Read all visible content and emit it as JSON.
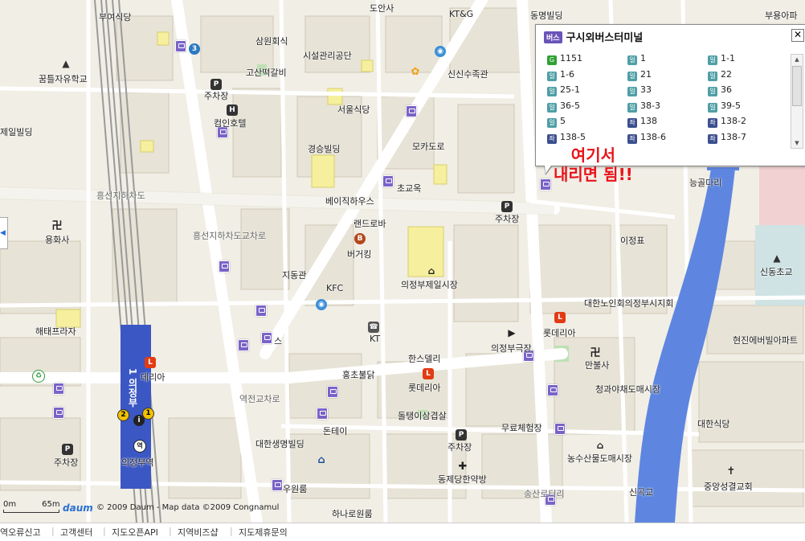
{
  "map": {
    "place_labels": [
      {
        "id": "buyeo-sikdang",
        "text": "부여식당"
      },
      {
        "id": "dongan-sa",
        "text": "도안사"
      },
      {
        "id": "ktg",
        "text": "KT&G"
      },
      {
        "id": "dongmyeong-building",
        "text": "동명빌딩"
      },
      {
        "id": "buyongarpa",
        "text": "부용아파"
      },
      {
        "id": "samwon-hoesik",
        "text": "삼원회식"
      },
      {
        "id": "sisul-gwanrigongdan",
        "text": "시설관리공단"
      },
      {
        "id": "goseon-tteokgalbi",
        "text": "고산떡갈비"
      },
      {
        "id": "sinsin-sujokgwan",
        "text": "신신수족관"
      },
      {
        "id": "kkumteul-school",
        "text": "꿈틀자유학교"
      },
      {
        "id": "jucha-1",
        "text": "주차장"
      },
      {
        "id": "seoul-sikdang",
        "text": "서울식당"
      },
      {
        "id": "compin-hotel",
        "text": "컴인호텔"
      },
      {
        "id": "jeil-building",
        "text": "제일빌딩"
      },
      {
        "id": "gyeongseung-building",
        "text": "경승빌딩"
      },
      {
        "id": "mokadoro",
        "text": "모카도로"
      },
      {
        "id": "heungseon-underpass",
        "text": "흥선지하차도"
      },
      {
        "id": "basic-house",
        "text": "베이직하우스"
      },
      {
        "id": "chogyook",
        "text": "초교옥"
      },
      {
        "id": "jucha-2",
        "text": "주차장"
      },
      {
        "id": "landrova",
        "text": "랜드로바"
      },
      {
        "id": "neunggoldari",
        "text": "능골다리"
      },
      {
        "id": "yonghwasa",
        "text": "용화사"
      },
      {
        "id": "heungseon-underpass-ro",
        "text": "흥선지하차도교차로"
      },
      {
        "id": "burger-king",
        "text": "버거킹"
      },
      {
        "id": "ijeongpyo",
        "text": "이정표"
      },
      {
        "id": "jidonggwan",
        "text": "지동관"
      },
      {
        "id": "uijeongbu-market",
        "text": "의정부제일시장"
      },
      {
        "id": "sindong-school",
        "text": "신동초교"
      },
      {
        "id": "kfc",
        "text": "KFC"
      },
      {
        "id": "elderly-assoc",
        "text": "대한노인회의정부시지회"
      },
      {
        "id": "haetae-plaza",
        "text": "해태프라자"
      },
      {
        "id": "kt",
        "text": "KT"
      },
      {
        "id": "lotteria-1",
        "text": "롯데리아"
      },
      {
        "id": "hyundai-apt",
        "text": "현진에버빌아파트"
      },
      {
        "id": "seuseu",
        "text": "스"
      },
      {
        "id": "uijeongbu-theater",
        "text": "의정부극장"
      },
      {
        "id": "hansdeli",
        "text": "한스델리"
      },
      {
        "id": "manbulsa",
        "text": "만불사"
      },
      {
        "id": "deria",
        "text": "데리아"
      },
      {
        "id": "hongcho-chicken",
        "text": "홍초불닭"
      },
      {
        "id": "lotteria-2",
        "text": "롯데리아"
      },
      {
        "id": "cheonggwa-market",
        "text": "청과야채도매시장"
      },
      {
        "id": "yeokjeon-ro",
        "text": "역전교차로"
      },
      {
        "id": "doltaengi",
        "text": "돌탱이삼겹살"
      },
      {
        "id": "daehan-sikdang",
        "text": "대한식당"
      },
      {
        "id": "dontei",
        "text": "돈테이"
      },
      {
        "id": "muryo-gym",
        "text": "무료체험장"
      },
      {
        "id": "daehan-life",
        "text": "대한생명빌딩"
      },
      {
        "id": "jucha-3",
        "text": "주차장"
      },
      {
        "id": "jucha-4",
        "text": "주차장"
      },
      {
        "id": "uijeongbu-station",
        "text": "의정부역"
      },
      {
        "id": "nonghyup-market",
        "text": "농수산물도매시장"
      },
      {
        "id": "dongje-clinic",
        "text": "동제당한약방"
      },
      {
        "id": "junganseong-church",
        "text": "중앙성결교회"
      },
      {
        "id": "uwon-building",
        "text": "우원룸"
      },
      {
        "id": "songsan-ro",
        "text": "송산로터리"
      },
      {
        "id": "singokgyo",
        "text": "신곡교"
      },
      {
        "id": "hana-building",
        "text": "하나로원룸"
      }
    ],
    "scale_label": "65m",
    "scale_zero": "0m",
    "logo_text": "daum",
    "copyright": "© 2009 Daum - Map data ©2009 Congnamul",
    "subway_line_label": "1 의정부",
    "left_tab_icon": "chevron-left-icon"
  },
  "popup": {
    "badge": "버스",
    "title": "구시외버스터미널",
    "close_label": "✕",
    "routes": [
      {
        "num": "1151",
        "color": "#2fa033",
        "tag": "G"
      },
      {
        "num": "1",
        "color": "#4f9fa6",
        "tag": "일"
      },
      {
        "num": "1-1",
        "color": "#4f9fa6",
        "tag": "일"
      },
      {
        "num": "1-6",
        "color": "#4f9fa6",
        "tag": "일"
      },
      {
        "num": "21",
        "color": "#4f9fa6",
        "tag": "일"
      },
      {
        "num": "22",
        "color": "#4f9fa6",
        "tag": "일"
      },
      {
        "num": "25-1",
        "color": "#4f9fa6",
        "tag": "일"
      },
      {
        "num": "33",
        "color": "#4f9fa6",
        "tag": "일"
      },
      {
        "num": "36",
        "color": "#4f9fa6",
        "tag": "일"
      },
      {
        "num": "36-5",
        "color": "#4f9fa6",
        "tag": "일"
      },
      {
        "num": "38-3",
        "color": "#4f9fa6",
        "tag": "일"
      },
      {
        "num": "39-5",
        "color": "#4f9fa6",
        "tag": "일"
      },
      {
        "num": "5",
        "color": "#4f9fa6",
        "tag": "일"
      },
      {
        "num": "138",
        "color": "#3c4f8f",
        "tag": "좌"
      },
      {
        "num": "138-2",
        "color": "#3c4f8f",
        "tag": "좌"
      },
      {
        "num": "138-5",
        "color": "#3c4f8f",
        "tag": "좌"
      },
      {
        "num": "138-6",
        "color": "#3c4f8f",
        "tag": "좌"
      },
      {
        "num": "138-7",
        "color": "#3c4f8f",
        "tag": "좌"
      }
    ]
  },
  "annotation": {
    "line1": "여기서",
    "line2": "내리면 됨!!"
  },
  "footer": {
    "links": [
      "역오류신고",
      "고객센터",
      "지도오픈API",
      "지역비즈샵",
      "지도제휴문의"
    ]
  }
}
